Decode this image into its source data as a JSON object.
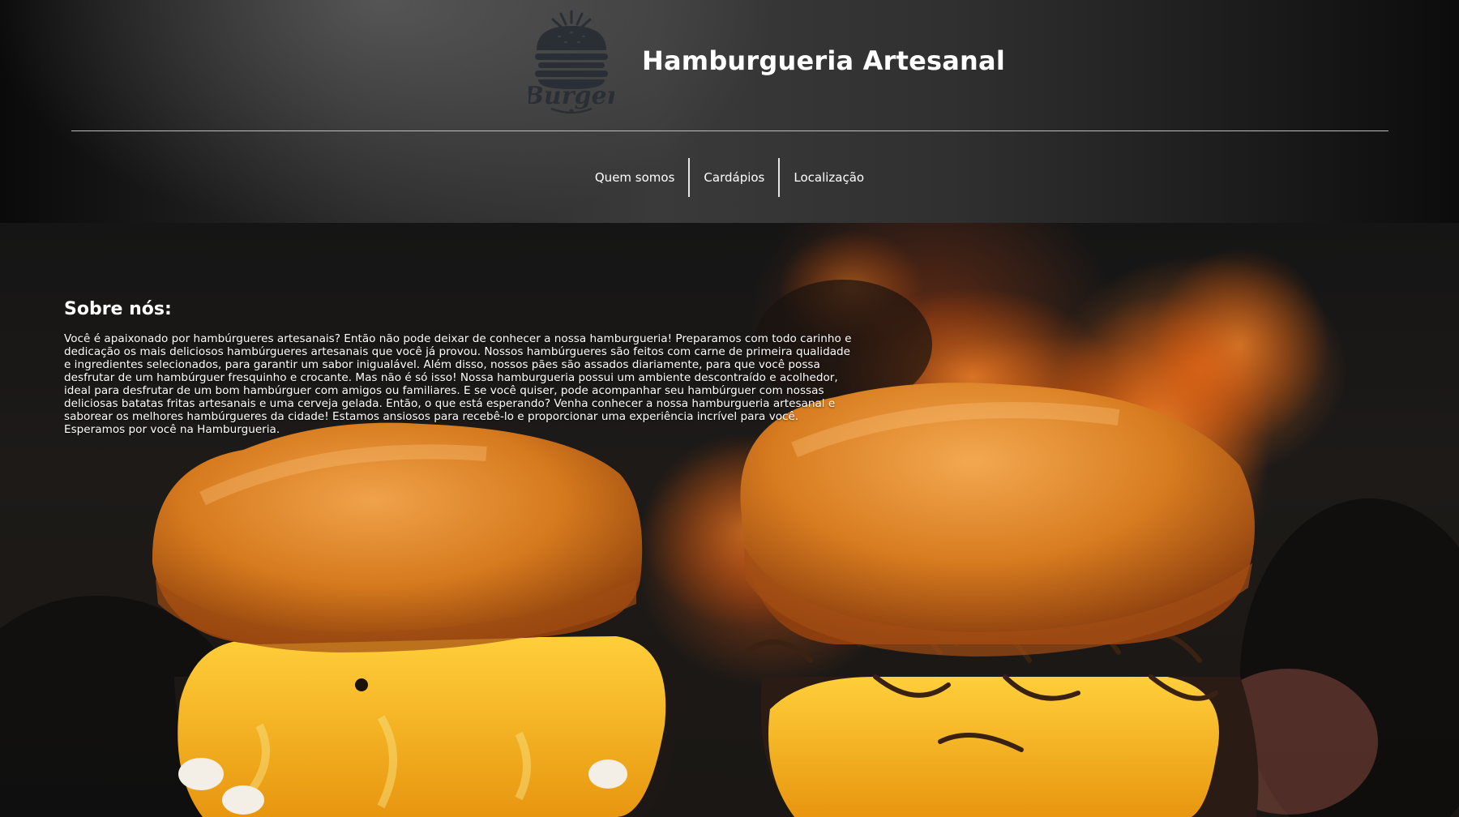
{
  "header": {
    "logo_text": "Burger",
    "title": "Hamburgueria Artesanal"
  },
  "nav": {
    "items": [
      {
        "label": "Quem somos"
      },
      {
        "label": "Cardápios"
      },
      {
        "label": "Localização"
      }
    ]
  },
  "about": {
    "title": "Sobre nós:",
    "text": "Você é apaixonado por hambúrgueres artesanais? Então não pode deixar de conhecer a nossa hamburgueria! Preparamos com todo carinho e dedicação os mais deliciosos hambúrgueres artesanais que você já provou. Nossos hambúrgueres são feitos com carne de primeira qualidade e ingredientes selecionados, para garantir um sabor inigualável. Além disso, nossos pães são assados diariamente, para que você possa desfrutar de um hambúrguer fresquinho e crocante. Mas não é só isso! Nossa hamburgueria possui um ambiente descontraído e acolhedor, ideal para desfrutar de um bom hambúrguer com amigos ou familiares. E se você quiser, pode acompanhar seu hambúrguer com nossas deliciosas batatas fritas artesanais e uma cerveja gelada. Então, o que está esperando? Venha conhecer a nossa hamburgueria artesanal e saborear os melhores hambúrgueres da cidade! Estamos ansiosos para recebê-lo e proporcionar uma experiência incrível para você. Esperamos por você na Hamburgueria."
  },
  "colors": {
    "header_bg": "#2e2e2e",
    "text": "#ffffff",
    "fire": "#ff6a14",
    "bun": "#e08a2a",
    "cheese": "#f2b21c"
  },
  "icons": {
    "logo": "burger-logo-icon"
  }
}
